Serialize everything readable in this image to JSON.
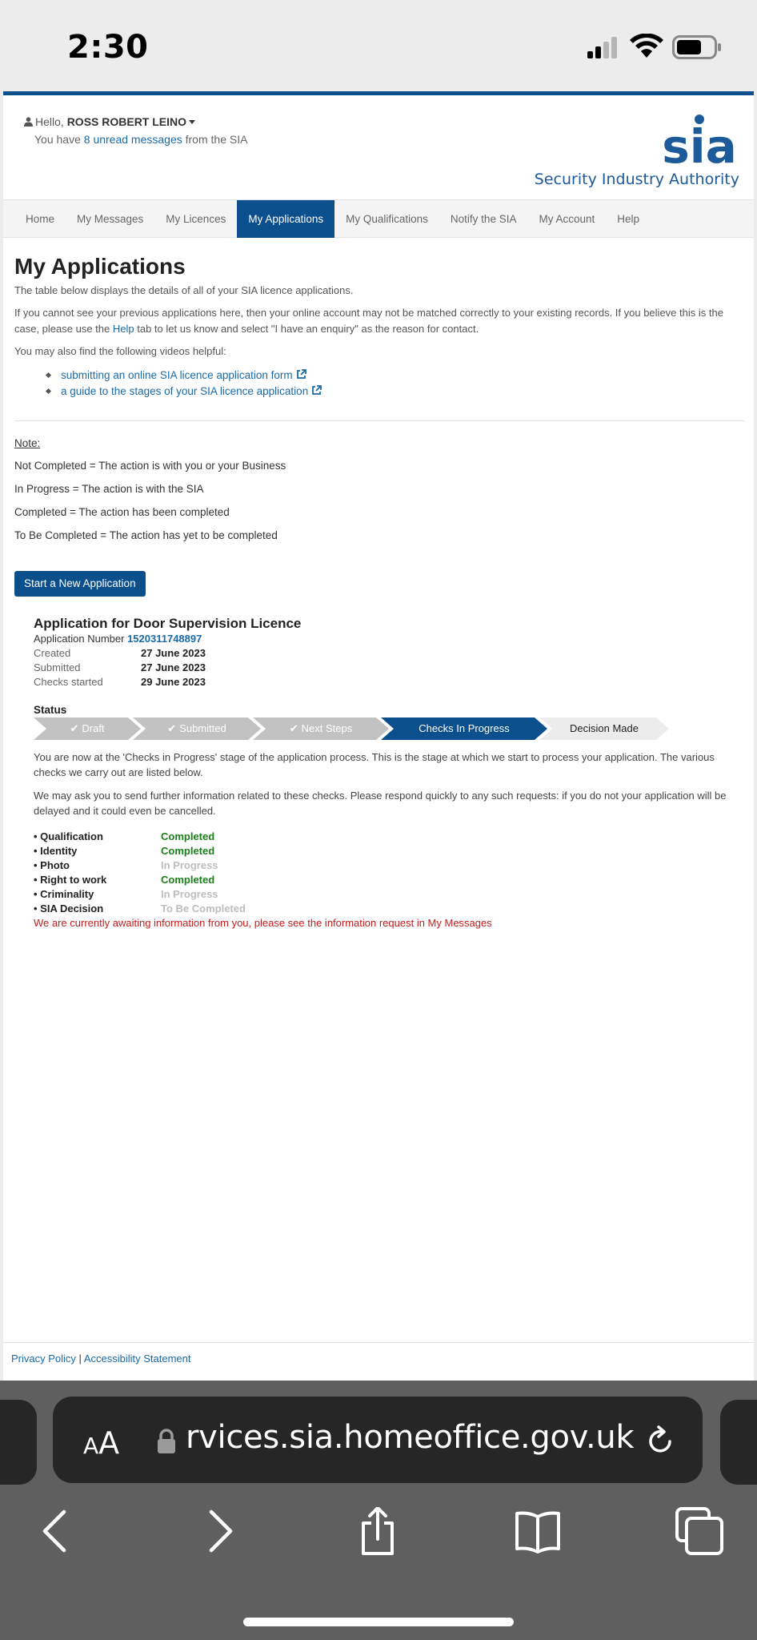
{
  "status_bar": {
    "time": "2:30"
  },
  "header": {
    "hello_prefix": "Hello,",
    "user_name": "ROSS ROBERT LEINO",
    "unread_prefix": "You have",
    "unread_link": "8 unread messages",
    "unread_suffix": "from the SIA",
    "logo_mark": "sia",
    "logo_text": "Security Industry Authority"
  },
  "nav": {
    "items": [
      {
        "label": "Home"
      },
      {
        "label": "My Messages"
      },
      {
        "label": "My Licences"
      },
      {
        "label": "My Applications",
        "active": true
      },
      {
        "label": "My Qualifications"
      },
      {
        "label": "Notify the SIA"
      },
      {
        "label": "My Account"
      },
      {
        "label": "Help"
      }
    ]
  },
  "main": {
    "title": "My Applications",
    "intro": "The table below displays the details of all of your SIA licence applications.",
    "account_note_1": "If you cannot see your previous applications here, then your online account may not be matched correctly to your existing records. If you believe this is the case, please use the",
    "account_note_link": "Help",
    "account_note_2": "tab to let us know and select \"I have an enquiry\" as the reason for contact.",
    "videos_intro": "You may also find the following videos helpful:",
    "videos": [
      {
        "label": "submitting an online SIA licence application form"
      },
      {
        "label": "a guide to the stages of your SIA licence application"
      }
    ],
    "note_heading": "Note:",
    "notes": [
      "Not Completed = The action is with you or your Business",
      "In Progress = The action is with the SIA",
      "Completed = The action has been completed",
      "To Be Completed = The action has yet to be completed"
    ],
    "start_button": "Start a New Application"
  },
  "application": {
    "title": "Application for Door Supervision Licence",
    "number_label": "Application Number",
    "number": "1520311748897",
    "created_label": "Created",
    "created": "27 June 2023",
    "submitted_label": "Submitted",
    "submitted": "27 June 2023",
    "checks_started_label": "Checks started",
    "checks_started": "29 June 2023",
    "status_heading": "Status",
    "steps": [
      {
        "label": "Draft",
        "state": "done"
      },
      {
        "label": "Submitted",
        "state": "done"
      },
      {
        "label": "Next Steps",
        "state": "done"
      },
      {
        "label": "Checks In Progress",
        "state": "current"
      },
      {
        "label": "Decision Made",
        "state": "todo"
      }
    ],
    "stage_text": "You are now at the 'Checks in Progress' stage of the application process. This is the stage at which we start to process your application. The various checks we carry out are listed below.",
    "request_text": "We may ask you to send further information related to these checks. Please respond quickly to any such requests: if you do not your application will be delayed and it could even be cancelled.",
    "checks": [
      {
        "name": "• Qualification",
        "status": "Completed"
      },
      {
        "name": "• Identity",
        "status": "Completed"
      },
      {
        "name": "• Photo",
        "status": "In Progress"
      },
      {
        "name": "• Right to work",
        "status": "Completed"
      },
      {
        "name": "• Criminality",
        "status": "In Progress"
      },
      {
        "name": "• SIA Decision",
        "status": "To Be Completed"
      }
    ],
    "alert": "We are currently awaiting information from you, please see the information request in My Messages"
  },
  "footer": {
    "privacy": "Privacy Policy",
    "separator": "|",
    "accessibility": "Accessibility Statement"
  },
  "browser": {
    "aa_small": "A",
    "aa_big": "A",
    "url": "rvices.sia.homeoffice.gov.uk"
  },
  "colors": {
    "brand_blue": "#0b4f8c",
    "link_blue": "#1a6aa8",
    "completed_green": "#1a7f1a",
    "alert_red": "#c41e1e"
  }
}
